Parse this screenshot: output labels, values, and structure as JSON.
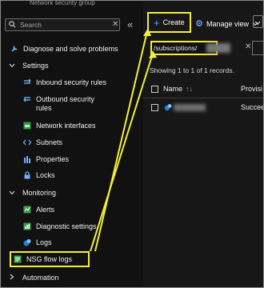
{
  "sidebar": {
    "resource_type": "Network security group",
    "search_placeholder": "Search",
    "items": [
      {
        "label": "Diagnose and solve problems"
      },
      {
        "label": "Inbound security rules"
      },
      {
        "label": "Outbound security rules"
      },
      {
        "label": "Network interfaces"
      },
      {
        "label": "Subnets"
      },
      {
        "label": "Properties"
      },
      {
        "label": "Locks"
      },
      {
        "label": "Alerts"
      },
      {
        "label": "Diagnostic settings"
      },
      {
        "label": "Logs"
      },
      {
        "label": "NSG flow logs"
      }
    ],
    "groups": [
      "Settings",
      "Monitoring",
      "Automation"
    ]
  },
  "toolbar": {
    "create_label": "Create",
    "manage_view_label": "Manage view"
  },
  "filter": {
    "value": "/subscriptions/"
  },
  "records_text": "Showing 1 to 1 of 1 records.",
  "table": {
    "headers": [
      "Name",
      "Provisi"
    ],
    "rows": [
      {
        "status": "Succeed"
      }
    ]
  },
  "colors": {
    "highlight": "#f5f035",
    "accent": "#4ea3ff",
    "background": "#111111"
  }
}
